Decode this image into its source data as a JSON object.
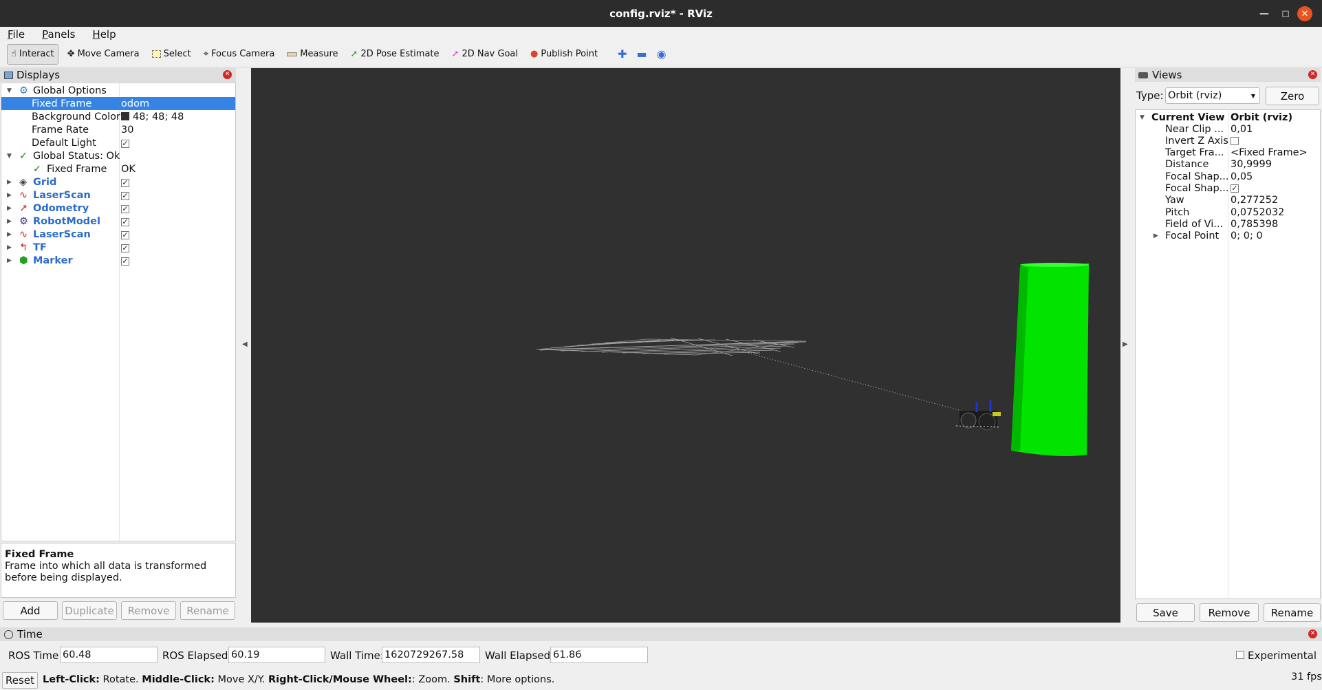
{
  "window": {
    "title": "config.rviz* - RViz"
  },
  "menu": {
    "file": "File",
    "panels": "Panels",
    "help": "Help"
  },
  "toolbar": {
    "interact": "Interact",
    "move_camera": "Move Camera",
    "select": "Select",
    "focus_camera": "Focus Camera",
    "measure": "Measure",
    "pose_estimate": "2D Pose Estimate",
    "nav_goal": "2D Nav Goal",
    "publish_point": "Publish Point"
  },
  "displays": {
    "title": "Displays",
    "global_options": "Global Options",
    "fixed_frame_label": "Fixed Frame",
    "fixed_frame_value": "odom",
    "bg_color_label": "Background Color",
    "bg_color_value": "48; 48; 48",
    "frame_rate_label": "Frame Rate",
    "frame_rate_value": "30",
    "default_light_label": "Default Light",
    "global_status": "Global Status: Ok",
    "status_fixed_frame": "Fixed Frame",
    "status_ok": "OK",
    "items": [
      {
        "label": "Grid",
        "icon": "grid-icon"
      },
      {
        "label": "LaserScan",
        "icon": "laserscan-icon"
      },
      {
        "label": "Odometry",
        "icon": "odometry-icon"
      },
      {
        "label": "RobotModel",
        "icon": "robot-icon"
      },
      {
        "label": "LaserScan",
        "icon": "laserscan-icon"
      },
      {
        "label": "TF",
        "icon": "tf-icon"
      },
      {
        "label": "Marker",
        "icon": "marker-icon"
      }
    ],
    "help_title": "Fixed Frame",
    "help_text": "Frame into which all data is transformed before being displayed.",
    "add": "Add",
    "duplicate": "Duplicate",
    "remove": "Remove",
    "rename": "Rename"
  },
  "views": {
    "title": "Views",
    "type_label": "Type:",
    "type_value": "Orbit (rviz)",
    "zero": "Zero",
    "current_view": "Current View",
    "current_view_value": "Orbit (rviz)",
    "props": [
      {
        "k": "Near Clip ...",
        "v": "0,01"
      },
      {
        "k": "Invert Z Axis",
        "v": ""
      },
      {
        "k": "Target Fra...",
        "v": "<Fixed Frame>"
      },
      {
        "k": "Distance",
        "v": "30,9999"
      },
      {
        "k": "Focal Shap...",
        "v": "0,05"
      },
      {
        "k": "Focal Shap...",
        "v": ""
      },
      {
        "k": "Yaw",
        "v": "0,277252"
      },
      {
        "k": "Pitch",
        "v": "0,0752032"
      },
      {
        "k": "Field of Vi...",
        "v": "0,785398"
      },
      {
        "k": "Focal Point",
        "v": "0; 0; 0"
      }
    ],
    "save": "Save",
    "remove": "Remove",
    "rename": "Rename"
  },
  "time": {
    "title": "Time",
    "ros_time_label": "ROS Time:",
    "ros_time": "60.48",
    "ros_elapsed_label": "ROS Elapsed:",
    "ros_elapsed": "60.19",
    "wall_time_label": "Wall Time:",
    "wall_time": "1620729267.58",
    "wall_elapsed_label": "Wall Elapsed:",
    "wall_elapsed": "61.86",
    "experimental": "Experimental"
  },
  "status": {
    "reset": "Reset",
    "left_click": "Left-Click:",
    "rotate": " Rotate. ",
    "middle_click": "Middle-Click:",
    "move": " Move X/Y. ",
    "right_click": "Right-Click/Mouse Wheel:",
    "zoom": ": Zoom. ",
    "shift": "Shift",
    "more": ": More options.",
    "fps": "31 fps"
  },
  "colors": {
    "accent": "#3584e4",
    "viewport_bg": "#303030",
    "marker_green": "#00e400",
    "close_orange": "#e95420"
  }
}
